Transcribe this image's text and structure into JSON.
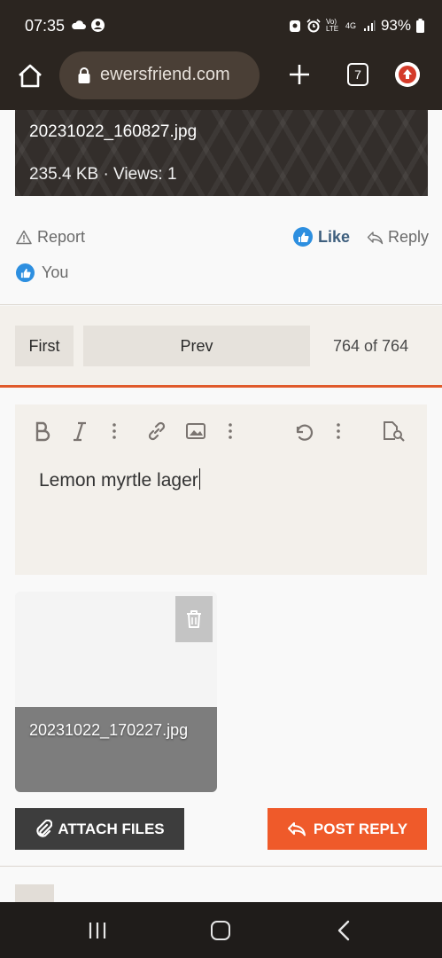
{
  "status_bar": {
    "time": "07:35",
    "battery": "93%",
    "left_icons": [
      "cloud-icon",
      "account-circle-icon"
    ],
    "right_icons": [
      "notification-app-icon",
      "alarm-icon",
      "volte-icon",
      "4g-data-icon",
      "signal-icon",
      "battery-icon"
    ],
    "volte_label": "Vo) LTE",
    "network_label": "4G"
  },
  "browser": {
    "url": "ewersfriend.com",
    "tab_count": "7"
  },
  "attachment_preview": {
    "filename": "20231022_160827.jpg",
    "meta": "235.4 KB · Views: 1"
  },
  "post_actions": {
    "report_label": "Report",
    "like_label": "Like",
    "reply_label": "Reply",
    "reactors_label": "You"
  },
  "pagination": {
    "first_label": "First",
    "prev_label": "Prev",
    "page_info": "764 of 764"
  },
  "editor": {
    "toolbar": [
      "bold-icon",
      "italic-icon",
      "more-options-icon",
      "link-icon",
      "image-icon",
      "more-options-icon",
      "undo-icon",
      "more-options-icon",
      "preview-icon"
    ],
    "text": "Lemon myrtle lager"
  },
  "pending_attachment": {
    "filename": "20231022_170227.jpg"
  },
  "buttons": {
    "attach_label": "ATTACH FILES",
    "post_label": "POST REPLY"
  },
  "colors": {
    "accent": "#ef5a2a",
    "like_blue": "#2d8fe0",
    "dark_button": "#3d3d3d",
    "browser_bar": "#2b2520"
  }
}
